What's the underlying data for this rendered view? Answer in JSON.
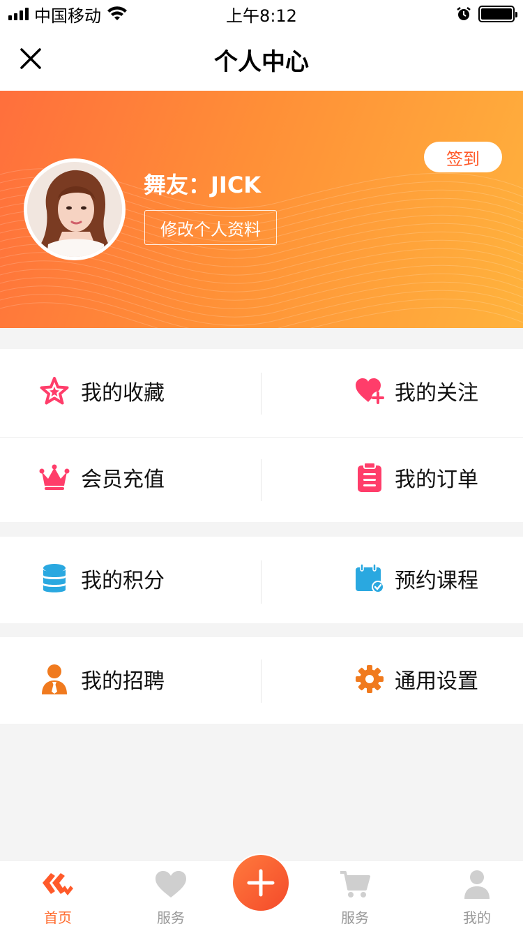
{
  "status_bar": {
    "carrier": "中国移动",
    "time": "上午8:12"
  },
  "header": {
    "title": "个人中心",
    "close_icon": "close-icon"
  },
  "profile": {
    "name": "舞友：JICK",
    "edit_label": "修改个人资料",
    "checkin_label": "签到"
  },
  "menu": {
    "favorites": "我的收藏",
    "follows": "我的关注",
    "membership": "会员充值",
    "orders": "我的订单",
    "points": "我的积分",
    "courses": "预约课程",
    "jobs": "我的招聘",
    "settings": "通用设置"
  },
  "tabs": [
    {
      "label": "首页",
      "icon": "home-logo-icon",
      "active": true
    },
    {
      "label": "服务",
      "icon": "heart-icon"
    },
    {
      "label": "",
      "icon": "plus-icon"
    },
    {
      "label": "服务",
      "icon": "cart-icon"
    },
    {
      "label": "我的",
      "icon": "user-icon"
    }
  ],
  "colors": {
    "accent": "#ff6a2c",
    "banner_start": "#ff6f3c",
    "banner_end": "#ffb33d",
    "pink": "#ff3d6a",
    "blue": "#2aa8e0"
  }
}
